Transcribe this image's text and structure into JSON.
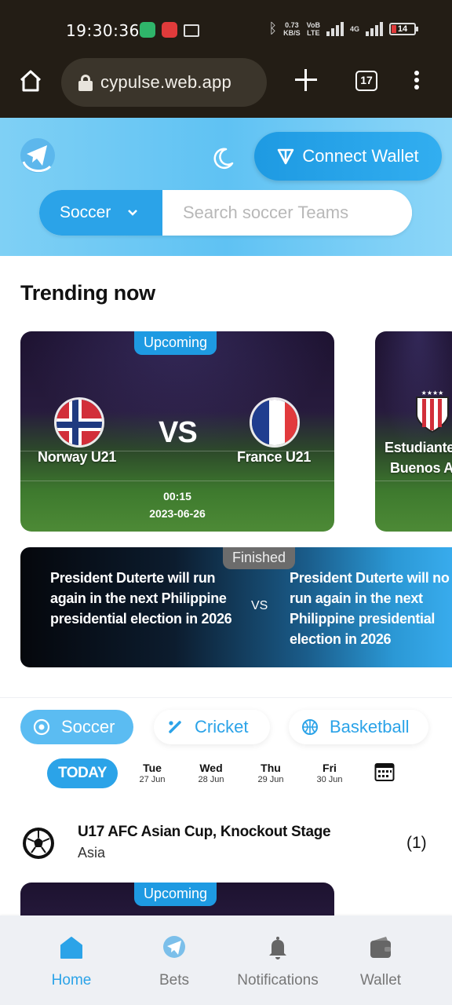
{
  "status_bar": {
    "time": "19:30:36",
    "speed_value": "0.73",
    "speed_unit": "KB/S",
    "network_top": "VoB",
    "network_bottom": "LTE",
    "signal2_label": "4G",
    "battery": "14"
  },
  "browser": {
    "url": "cypulse.web.app",
    "tab_count": "17"
  },
  "header": {
    "connect_wallet_label": "Connect Wallet",
    "sport_select_value": "Soccer",
    "search_placeholder": "Search soccer Teams",
    "accent_color": "#2ba3e8"
  },
  "trending": {
    "title": "Trending now",
    "matches": [
      {
        "status": "Upcoming",
        "home": "Norway U21",
        "away": "France U21",
        "vs": "VS",
        "time": "00:15",
        "date": "2023-06-26"
      },
      {
        "home": "Estudiante",
        "home_line2": "Buenos A"
      }
    ],
    "prediction": {
      "status": "Finished",
      "option_a": "President Duterte will run again in the next Philippine presidential election in 2026",
      "option_b": "President Duterte will no run again in the next Philippine presidential election in 2026",
      "vs": "VS"
    }
  },
  "sport_tabs": [
    {
      "label": "Soccer",
      "icon": "soccer-icon",
      "active": true
    },
    {
      "label": "Cricket",
      "icon": "cricket-icon",
      "active": false
    },
    {
      "label": "Basketball",
      "icon": "basketball-icon",
      "active": false
    }
  ],
  "dates": {
    "today_label": "TODAY",
    "days": [
      {
        "day": "Tue",
        "date": "27 Jun"
      },
      {
        "day": "Wed",
        "date": "28 Jun"
      },
      {
        "day": "Thu",
        "date": "29 Jun"
      },
      {
        "day": "Fri",
        "date": "30 Jun"
      }
    ]
  },
  "league": {
    "name": "U17 AFC Asian Cup, Knockout Stage",
    "region": "Asia",
    "count": "(1)",
    "next_match_status": "Upcoming"
  },
  "bottom_nav": [
    {
      "label": "Home",
      "icon": "home-icon",
      "active": true
    },
    {
      "label": "Bets",
      "icon": "bets-icon",
      "active": false
    },
    {
      "label": "Notifications",
      "icon": "bell-icon",
      "active": false
    },
    {
      "label": "Wallet",
      "icon": "wallet-icon",
      "active": false
    }
  ]
}
